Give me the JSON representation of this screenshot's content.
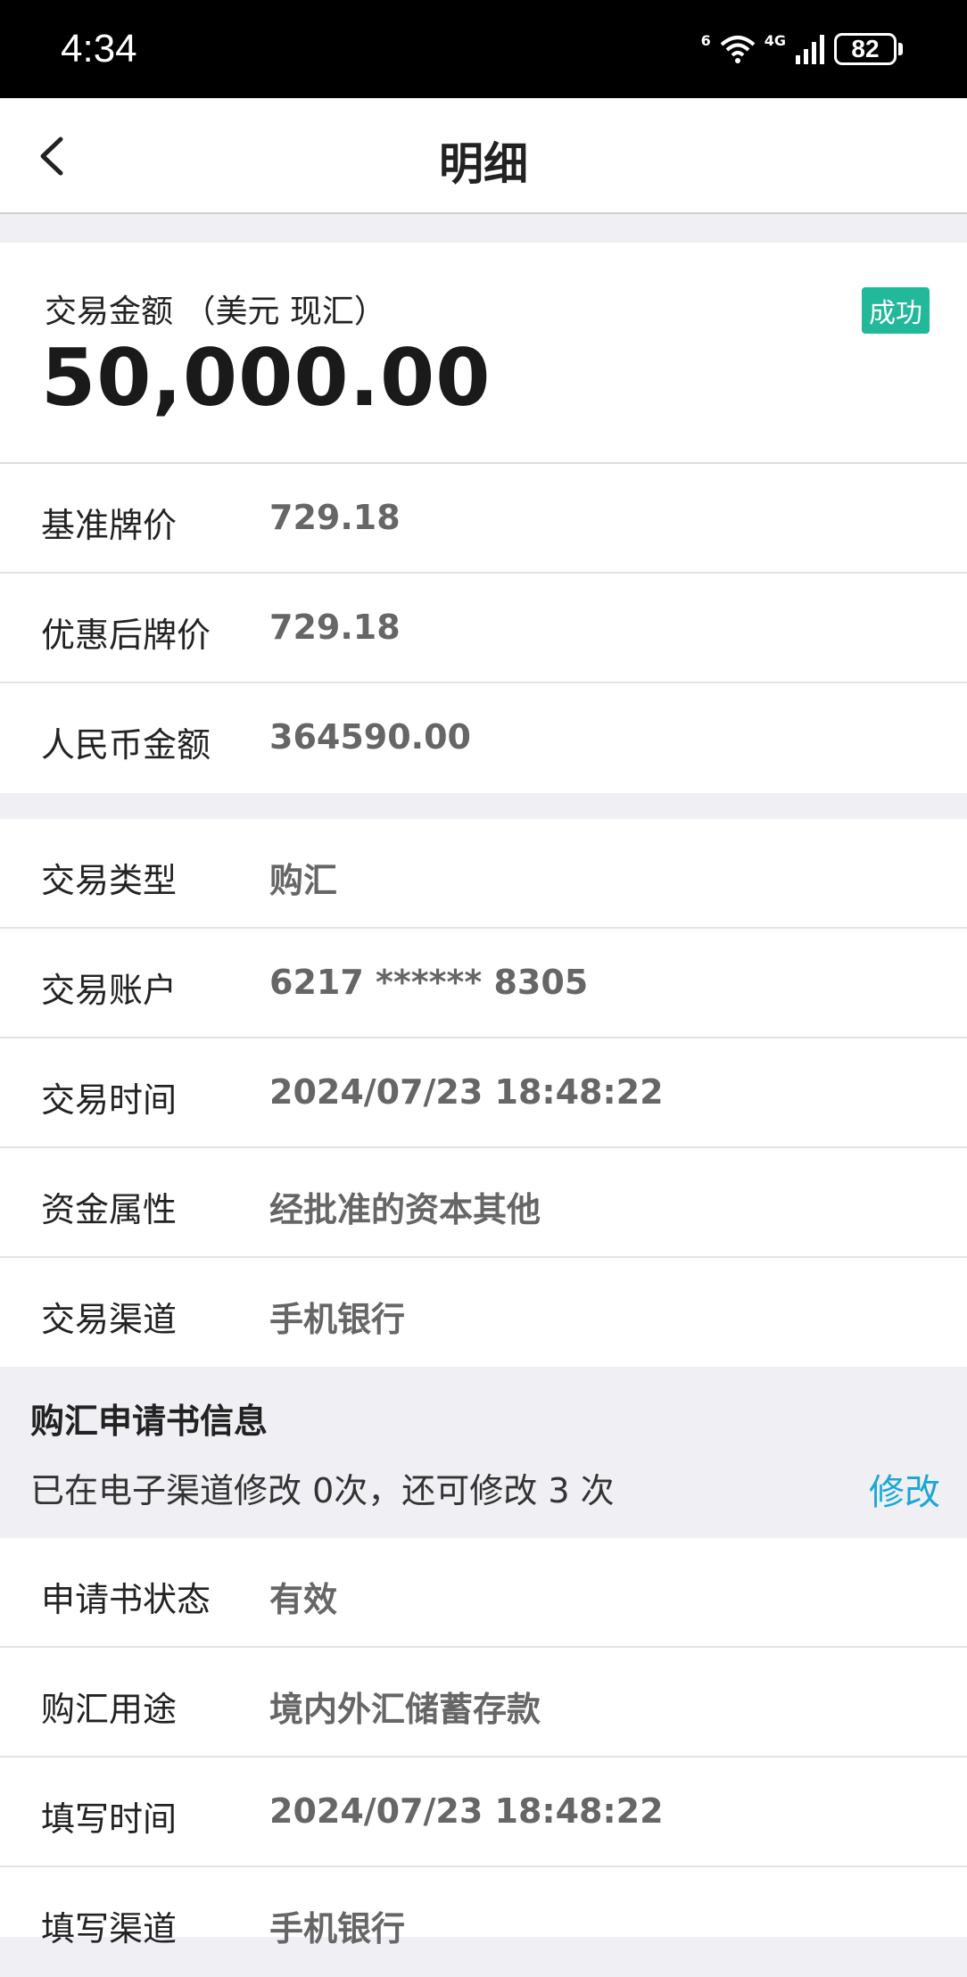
{
  "status_bar": {
    "time": "4:34",
    "wifi_label": "6",
    "network_label": "4G",
    "battery": "82"
  },
  "nav": {
    "title": "明细"
  },
  "amount": {
    "label": "交易金额 （美元 现汇）",
    "value": "50,000.00",
    "status": "成功"
  },
  "rates": [
    {
      "key": "基准牌价",
      "value": "729.18"
    },
    {
      "key": "优惠后牌价",
      "value": "729.18"
    },
    {
      "key": "人民币金额",
      "value": "364590.00"
    }
  ],
  "details": [
    {
      "key": "交易类型",
      "value": "购汇"
    },
    {
      "key": "交易账户",
      "value": "6217 ****** 8305"
    },
    {
      "key": "交易时间",
      "value": "2024/07/23 18:48:22"
    },
    {
      "key": "资金属性",
      "value": "经批准的资本其他"
    },
    {
      "key": "交易渠道",
      "value": "手机银行"
    }
  ],
  "application": {
    "heading": "购汇申请书信息",
    "note": "已在电子渠道修改 0次，还可修改 3 次",
    "edit_label": "修改",
    "rows": [
      {
        "key": "申请书状态",
        "value": "有效"
      },
      {
        "key": "购汇用途",
        "value": "境内外汇储蓄存款"
      },
      {
        "key": "填写时间",
        "value": "2024/07/23 18:48:22"
      },
      {
        "key": "填写渠道",
        "value": "手机银行"
      }
    ]
  },
  "colors": {
    "success_badge": "#22b89a",
    "link": "#1aa8d4"
  }
}
